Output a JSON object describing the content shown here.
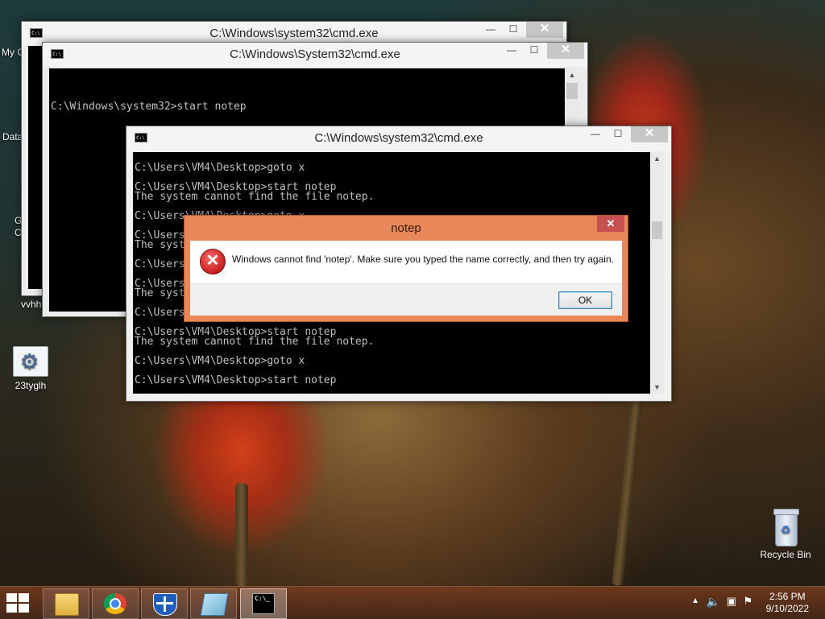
{
  "desktop": {
    "icons": [
      {
        "label": "23tyglh"
      },
      {
        "label": "Recycle Bin"
      }
    ],
    "partial_icons": [
      {
        "label": "My C"
      },
      {
        "label": "Data"
      },
      {
        "label": "G"
      },
      {
        "label": "C"
      },
      {
        "label": "vvhh"
      }
    ]
  },
  "windows": {
    "back": {
      "title": "C:\\Windows\\system32\\cmd.exe"
    },
    "middle": {
      "title": "C:\\Windows\\System32\\cmd.exe",
      "lines": [
        "C:\\Windows\\system32>start notep"
      ]
    },
    "front": {
      "title": "C:\\Windows\\system32\\cmd.exe",
      "lines": [
        "C:\\Users\\VM4\\Desktop>goto x",
        "",
        "C:\\Users\\VM4\\Desktop>start notep",
        "The system cannot find the file notep.",
        "",
        "C:\\Users\\VM4\\Desktop>goto x",
        "",
        "C:\\Users\\VM4\\Desktop>start notep",
        "The system cannot find the file notep.",
        "",
        "C:\\Users\\VM4\\Desktop>goto x",
        "",
        "C:\\Users\\VM4\\Desktop>start notep",
        "The system cannot find the file notep.",
        "",
        "C:\\Users\\VM4\\Desktop>goto x",
        "",
        "C:\\Users\\VM4\\Desktop>start notep",
        "The system cannot find the file notep.",
        "",
        "C:\\Users\\VM4\\Desktop>goto x",
        "",
        "C:\\Users\\VM4\\Desktop>start notep"
      ]
    }
  },
  "dialog": {
    "title": "notep",
    "message": "Windows cannot find 'notep'. Make sure you typed the name correctly, and then try again.",
    "ok_label": "OK",
    "close_glyph": "✕",
    "icon": "error-icon"
  },
  "window_buttons": {
    "minimize": "—",
    "maximize": "☐",
    "close": "✕"
  },
  "taskbar": {
    "apps": [
      "file-explorer-icon",
      "chrome-icon",
      "shield-icon",
      "notepad-icon",
      "cmd-icon"
    ],
    "time": "2:56 PM",
    "date": "9/10/2022"
  }
}
